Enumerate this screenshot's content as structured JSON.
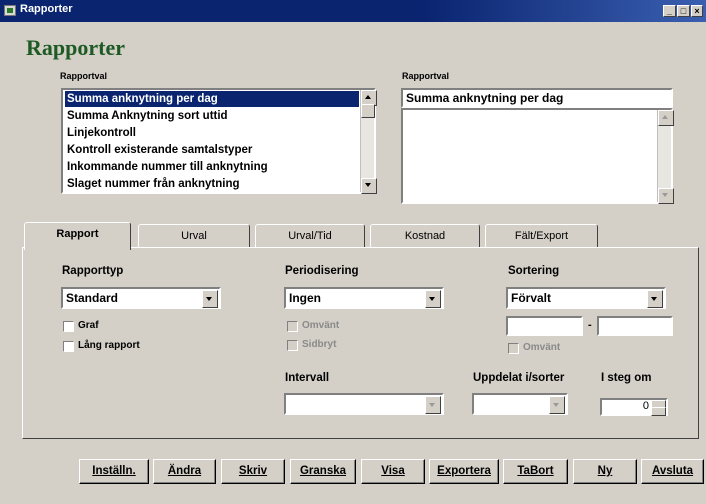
{
  "window": {
    "title": "Rapporter",
    "heading": "Rapporter"
  },
  "report_select": {
    "label": "Rapportval",
    "items": [
      "Summa anknytning per dag",
      "Summa Anknytning sort uttid",
      "Linjekontroll",
      "Kontroll existerande samtalstyper",
      "Inkommande nummer till anknytning",
      "Slaget nummer från anknytning"
    ],
    "selected_index": 0
  },
  "report_preview": {
    "label": "Rapportval",
    "text": "Summa anknytning per dag"
  },
  "tabs": [
    "Rapport",
    "Urval",
    "Urval/Tid",
    "Kostnad",
    "Fält/Export"
  ],
  "active_tab": "Rapport",
  "rapport_tab": {
    "rapporttyp": {
      "label": "Rapporttyp",
      "value": "Standard"
    },
    "graf": {
      "label": "Graf",
      "checked": false
    },
    "lang_rapport": {
      "label": "Lång rapport",
      "checked": false
    },
    "periodisering": {
      "label": "Periodisering",
      "value": "Ingen"
    },
    "periodisering_omvant": {
      "label": "Omvänt",
      "checked": false,
      "enabled": false
    },
    "periodisering_sidbryt": {
      "label": "Sidbryt",
      "checked": false,
      "enabled": false
    },
    "sortering": {
      "label": "Sortering",
      "value": "Förvalt"
    },
    "sortering_range_separator": "-",
    "sortering_omvant": {
      "label": "Omvänt",
      "checked": false,
      "enabled": false
    },
    "intervall": {
      "label": "Intervall",
      "value": ""
    },
    "uppdelat": {
      "label": "Uppdelat i/sorter",
      "value": ""
    },
    "i_steg_om": {
      "label": "I steg om",
      "value": "0"
    }
  },
  "buttons": [
    "Inställn.",
    "Ändra",
    "Skriv",
    "Granska",
    "Visa",
    "Exportera",
    "TaBort",
    "Ny",
    "Avsluta"
  ]
}
